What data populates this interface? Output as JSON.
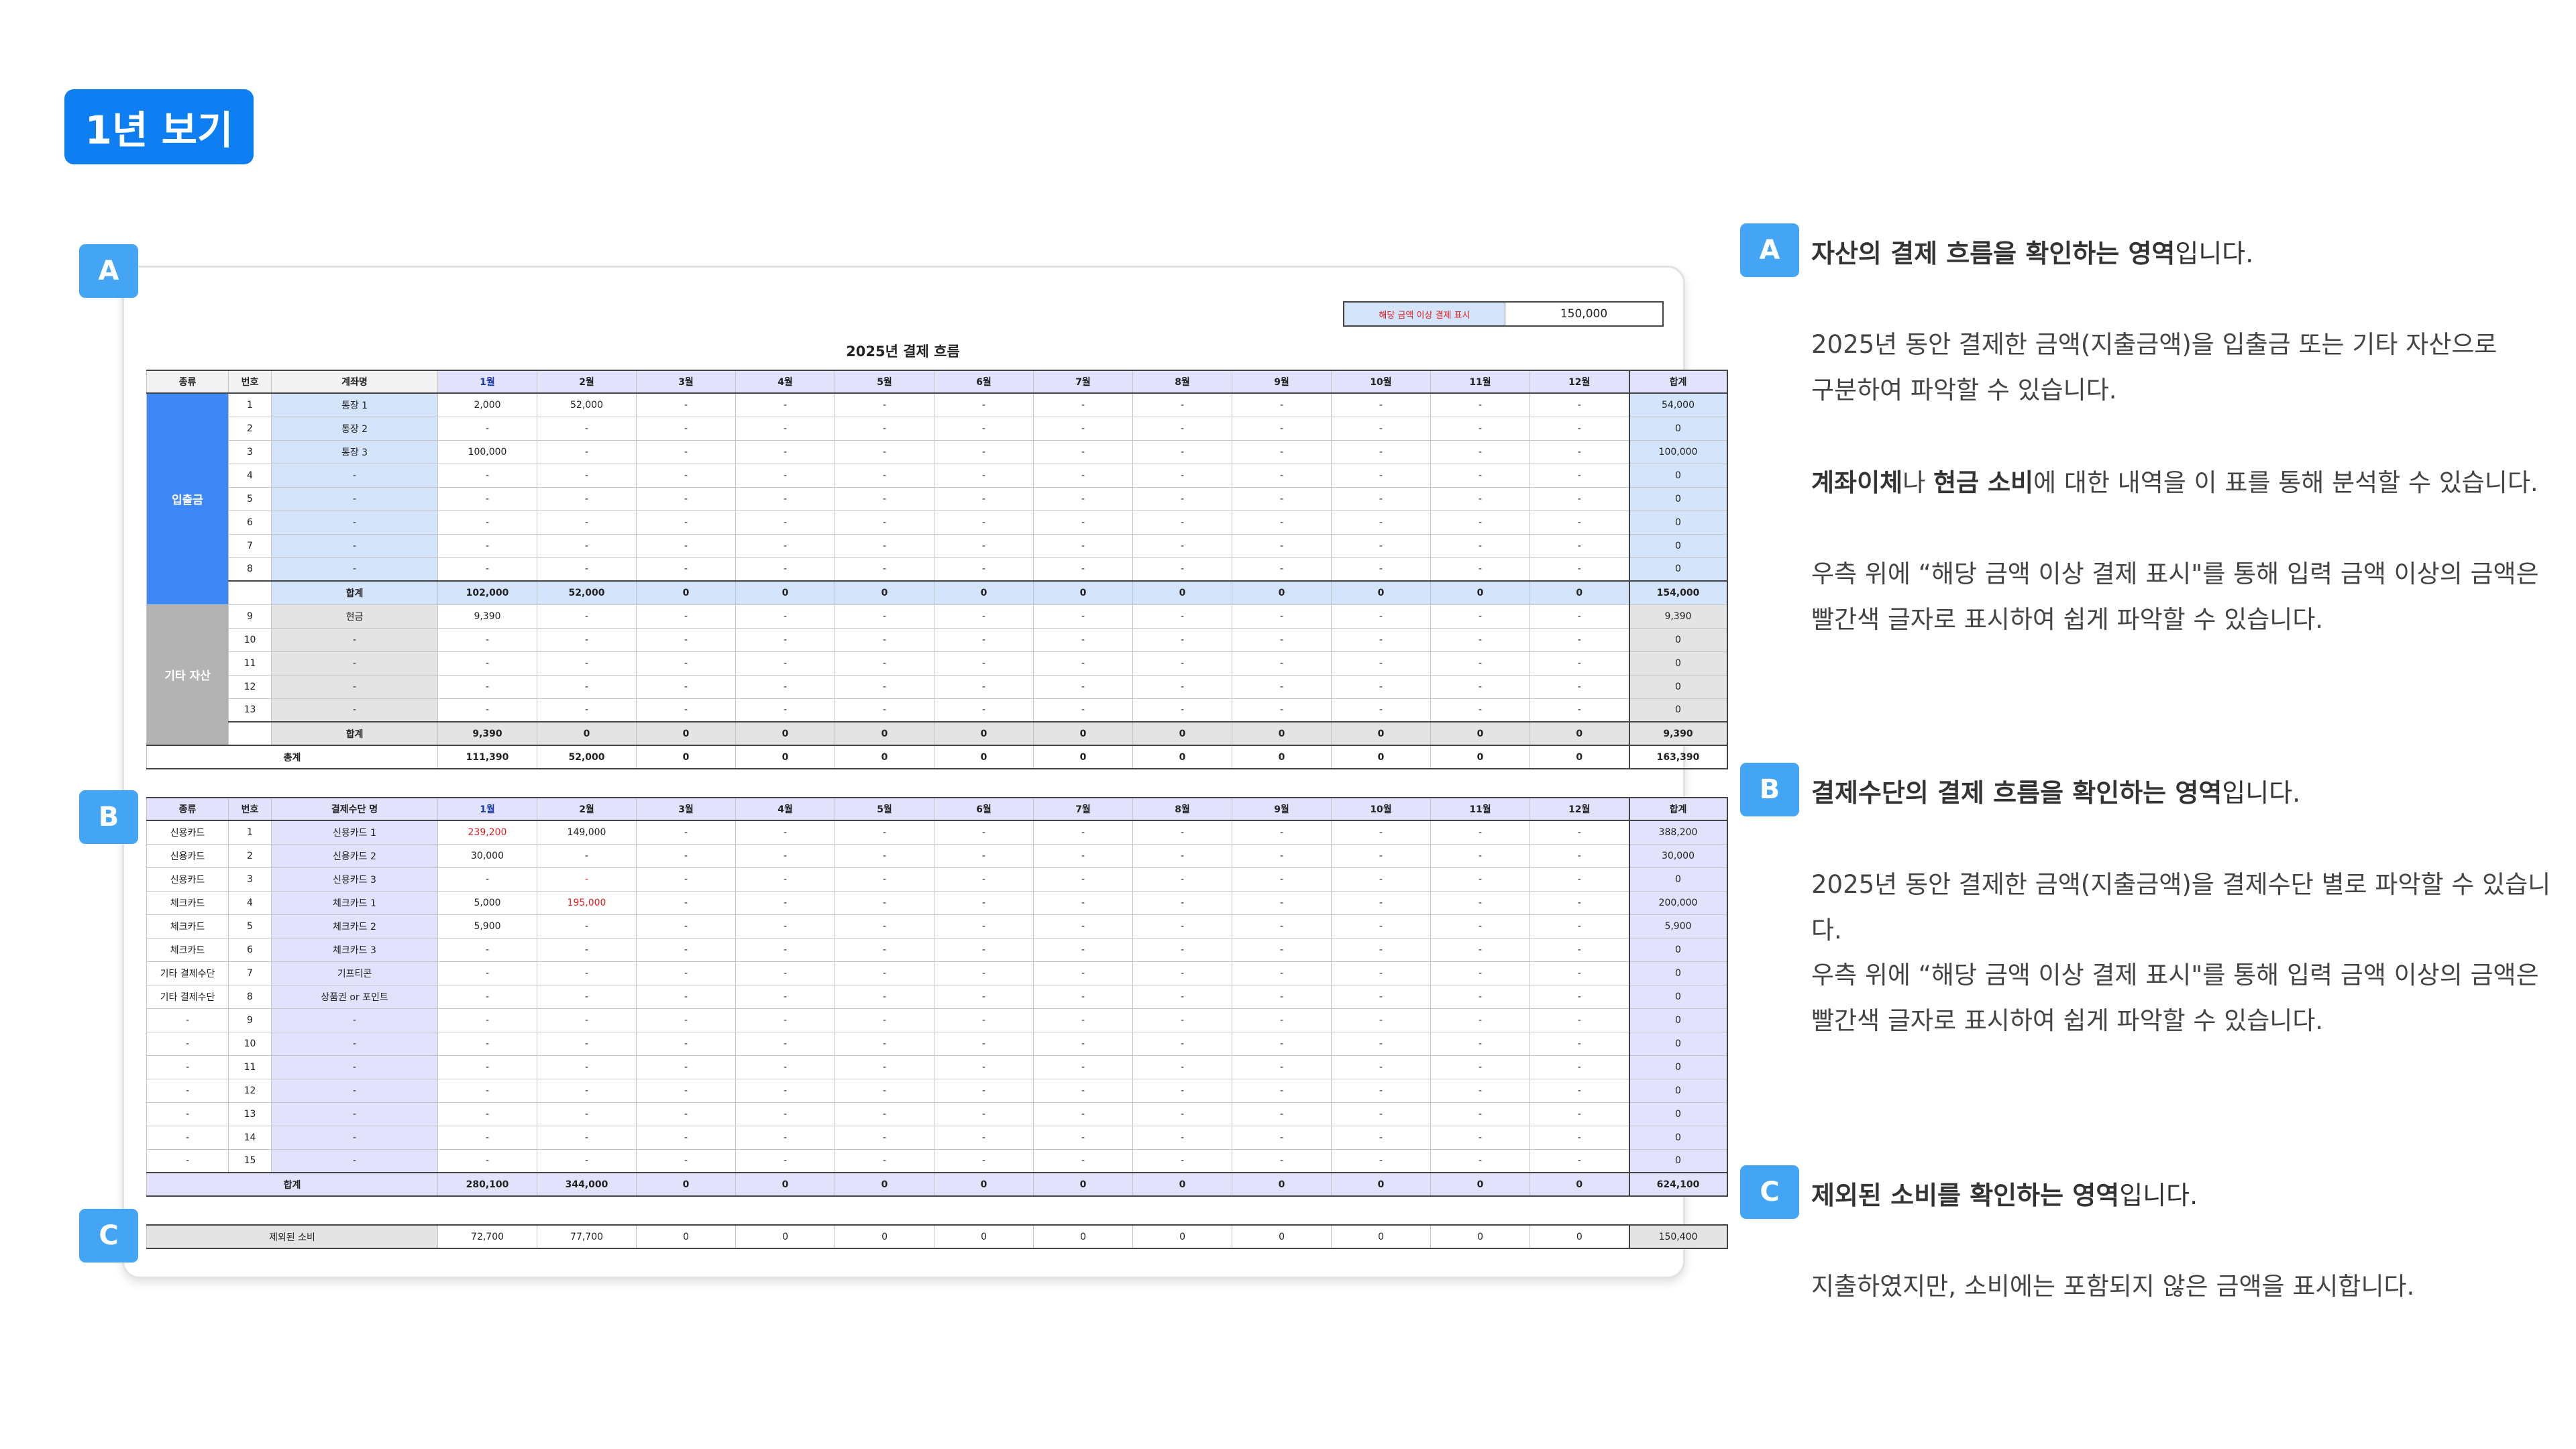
{
  "page": {
    "title": "1년 보기"
  },
  "markers": {
    "a": "A",
    "b": "B",
    "c": "C"
  },
  "colors": {
    "accent": "#0d7ff2",
    "marker": "#45a5f5",
    "asset_blue": "#3f87f5",
    "asset_gray": "#b3b3b3",
    "highlight_red": "#e02020"
  },
  "sheet": {
    "title": "2025년 결제 흐름",
    "threshold": {
      "label": "해당 금액 이상 결제 표시",
      "value": "150,000"
    },
    "months": [
      "1월",
      "2월",
      "3월",
      "4월",
      "5월",
      "6월",
      "7월",
      "8월",
      "9월",
      "10월",
      "11월",
      "12월"
    ],
    "total_header": "합계",
    "asset_table": {
      "headers": {
        "type": "종류",
        "num": "번호",
        "name": "계좌명"
      },
      "groups": [
        {
          "category": "입출금",
          "rows": [
            {
              "num": "1",
              "name": "통장 1",
              "months": [
                "2,000",
                "52,000",
                "-",
                "-",
                "-",
                "-",
                "-",
                "-",
                "-",
                "-",
                "-",
                "-"
              ],
              "total": "54,000"
            },
            {
              "num": "2",
              "name": "통장 2",
              "months": [
                "-",
                "-",
                "-",
                "-",
                "-",
                "-",
                "-",
                "-",
                "-",
                "-",
                "-",
                "-"
              ],
              "total": "0"
            },
            {
              "num": "3",
              "name": "통장 3",
              "months": [
                "100,000",
                "-",
                "-",
                "-",
                "-",
                "-",
                "-",
                "-",
                "-",
                "-",
                "-",
                "-"
              ],
              "total": "100,000"
            },
            {
              "num": "4",
              "name": "-",
              "months": [
                "-",
                "-",
                "-",
                "-",
                "-",
                "-",
                "-",
                "-",
                "-",
                "-",
                "-",
                "-"
              ],
              "total": "0"
            },
            {
              "num": "5",
              "name": "-",
              "months": [
                "-",
                "-",
                "-",
                "-",
                "-",
                "-",
                "-",
                "-",
                "-",
                "-",
                "-",
                "-"
              ],
              "total": "0"
            },
            {
              "num": "6",
              "name": "-",
              "months": [
                "-",
                "-",
                "-",
                "-",
                "-",
                "-",
                "-",
                "-",
                "-",
                "-",
                "-",
                "-"
              ],
              "total": "0"
            },
            {
              "num": "7",
              "name": "-",
              "months": [
                "-",
                "-",
                "-",
                "-",
                "-",
                "-",
                "-",
                "-",
                "-",
                "-",
                "-",
                "-"
              ],
              "total": "0"
            },
            {
              "num": "8",
              "name": "-",
              "months": [
                "-",
                "-",
                "-",
                "-",
                "-",
                "-",
                "-",
                "-",
                "-",
                "-",
                "-",
                "-"
              ],
              "total": "0"
            }
          ],
          "subtotal": {
            "label": "합계",
            "months": [
              "102,000",
              "52,000",
              "0",
              "0",
              "0",
              "0",
              "0",
              "0",
              "0",
              "0",
              "0",
              "0"
            ],
            "total": "154,000"
          }
        },
        {
          "category": "기타 자산",
          "rows": [
            {
              "num": "9",
              "name": "현금",
              "months": [
                "9,390",
                "-",
                "-",
                "-",
                "-",
                "-",
                "-",
                "-",
                "-",
                "-",
                "-",
                "-"
              ],
              "total": "9,390"
            },
            {
              "num": "10",
              "name": "-",
              "months": [
                "-",
                "-",
                "-",
                "-",
                "-",
                "-",
                "-",
                "-",
                "-",
                "-",
                "-",
                "-"
              ],
              "total": "0"
            },
            {
              "num": "11",
              "name": "-",
              "months": [
                "-",
                "-",
                "-",
                "-",
                "-",
                "-",
                "-",
                "-",
                "-",
                "-",
                "-",
                "-"
              ],
              "total": "0"
            },
            {
              "num": "12",
              "name": "-",
              "months": [
                "-",
                "-",
                "-",
                "-",
                "-",
                "-",
                "-",
                "-",
                "-",
                "-",
                "-",
                "-"
              ],
              "total": "0"
            },
            {
              "num": "13",
              "name": "-",
              "months": [
                "-",
                "-",
                "-",
                "-",
                "-",
                "-",
                "-",
                "-",
                "-",
                "-",
                "-",
                "-"
              ],
              "total": "0"
            }
          ],
          "subtotal": {
            "label": "합계",
            "months": [
              "9,390",
              "0",
              "0",
              "0",
              "0",
              "0",
              "0",
              "0",
              "0",
              "0",
              "0",
              "0"
            ],
            "total": "9,390"
          }
        }
      ],
      "grand_total": {
        "label": "총계",
        "months": [
          "111,390",
          "52,000",
          "0",
          "0",
          "0",
          "0",
          "0",
          "0",
          "0",
          "0",
          "0",
          "0"
        ],
        "total": "163,390"
      }
    },
    "payment_table": {
      "headers": {
        "type": "종류",
        "num": "번호",
        "name": "결제수단 명"
      },
      "rows": [
        {
          "type": "신용카드",
          "num": "1",
          "name": "신용카드 1",
          "months": [
            "239,200",
            "149,000",
            "-",
            "-",
            "-",
            "-",
            "-",
            "-",
            "-",
            "-",
            "-",
            "-"
          ],
          "total": "388,200",
          "red": [
            0
          ]
        },
        {
          "type": "신용카드",
          "num": "2",
          "name": "신용카드 2",
          "months": [
            "30,000",
            "-",
            "-",
            "-",
            "-",
            "-",
            "-",
            "-",
            "-",
            "-",
            "-",
            "-"
          ],
          "total": "30,000",
          "red": []
        },
        {
          "type": "신용카드",
          "num": "3",
          "name": "신용카드 3",
          "months": [
            "-",
            "-",
            "-",
            "-",
            "-",
            "-",
            "-",
            "-",
            "-",
            "-",
            "-",
            "-"
          ],
          "total": "0",
          "red": [
            1
          ]
        },
        {
          "type": "체크카드",
          "num": "4",
          "name": "체크카드 1",
          "months": [
            "5,000",
            "195,000",
            "-",
            "-",
            "-",
            "-",
            "-",
            "-",
            "-",
            "-",
            "-",
            "-"
          ],
          "total": "200,000",
          "red": [
            1
          ]
        },
        {
          "type": "체크카드",
          "num": "5",
          "name": "체크카드 2",
          "months": [
            "5,900",
            "-",
            "-",
            "-",
            "-",
            "-",
            "-",
            "-",
            "-",
            "-",
            "-",
            "-"
          ],
          "total": "5,900",
          "red": []
        },
        {
          "type": "체크카드",
          "num": "6",
          "name": "체크카드 3",
          "months": [
            "-",
            "-",
            "-",
            "-",
            "-",
            "-",
            "-",
            "-",
            "-",
            "-",
            "-",
            "-"
          ],
          "total": "0",
          "red": []
        },
        {
          "type": "기타 결제수단",
          "num": "7",
          "name": "기프티콘",
          "months": [
            "-",
            "-",
            "-",
            "-",
            "-",
            "-",
            "-",
            "-",
            "-",
            "-",
            "-",
            "-"
          ],
          "total": "0",
          "red": []
        },
        {
          "type": "기타 결제수단",
          "num": "8",
          "name": "상품권 or 포인트",
          "months": [
            "-",
            "-",
            "-",
            "-",
            "-",
            "-",
            "-",
            "-",
            "-",
            "-",
            "-",
            "-"
          ],
          "total": "0",
          "red": []
        },
        {
          "type": "-",
          "num": "9",
          "name": "-",
          "months": [
            "-",
            "-",
            "-",
            "-",
            "-",
            "-",
            "-",
            "-",
            "-",
            "-",
            "-",
            "-"
          ],
          "total": "0",
          "red": []
        },
        {
          "type": "-",
          "num": "10",
          "name": "-",
          "months": [
            "-",
            "-",
            "-",
            "-",
            "-",
            "-",
            "-",
            "-",
            "-",
            "-",
            "-",
            "-"
          ],
          "total": "0",
          "red": []
        },
        {
          "type": "-",
          "num": "11",
          "name": "-",
          "months": [
            "-",
            "-",
            "-",
            "-",
            "-",
            "-",
            "-",
            "-",
            "-",
            "-",
            "-",
            "-"
          ],
          "total": "0",
          "red": []
        },
        {
          "type": "-",
          "num": "12",
          "name": "-",
          "months": [
            "-",
            "-",
            "-",
            "-",
            "-",
            "-",
            "-",
            "-",
            "-",
            "-",
            "-",
            "-"
          ],
          "total": "0",
          "red": []
        },
        {
          "type": "-",
          "num": "13",
          "name": "-",
          "months": [
            "-",
            "-",
            "-",
            "-",
            "-",
            "-",
            "-",
            "-",
            "-",
            "-",
            "-",
            "-"
          ],
          "total": "0",
          "red": []
        },
        {
          "type": "-",
          "num": "14",
          "name": "-",
          "months": [
            "-",
            "-",
            "-",
            "-",
            "-",
            "-",
            "-",
            "-",
            "-",
            "-",
            "-",
            "-"
          ],
          "total": "0",
          "red": []
        },
        {
          "type": "-",
          "num": "15",
          "name": "-",
          "months": [
            "-",
            "-",
            "-",
            "-",
            "-",
            "-",
            "-",
            "-",
            "-",
            "-",
            "-",
            "-"
          ],
          "total": "0",
          "red": []
        }
      ],
      "total": {
        "label": "합계",
        "months": [
          "280,100",
          "344,000",
          "0",
          "0",
          "0",
          "0",
          "0",
          "0",
          "0",
          "0",
          "0",
          "0"
        ],
        "total": "624,100"
      }
    },
    "excluded": {
      "label": "제외된 소비",
      "months": [
        "72,700",
        "77,700",
        "0",
        "0",
        "0",
        "0",
        "0",
        "0",
        "0",
        "0",
        "0",
        "0"
      ],
      "total": "150,400"
    }
  },
  "notes": {
    "a": {
      "marker": "A",
      "heading_bold": "자산의 결제 흐름을 확인하는 영역",
      "heading_rest": "입니다.",
      "p1_line1": "2025년 동안 결제한 금액(지출금액)을 입출금 또는 기타 자산으로",
      "p1_line2": "구분하여 파악할 수 있습니다.",
      "p2_bold1": "계좌이체",
      "p2_mid": "나 ",
      "p2_bold2": "현금 소비",
      "p2_rest": "에 대한 내역을 이 표를 통해 분석할 수 있습니다.",
      "p3_line1": "우측 위에 “해당 금액 이상 결제 표시\"를 통해 입력 금액 이상의 금액은",
      "p3_line2": "빨간색 글자로 표시하여 쉽게 파악할 수 있습니다."
    },
    "b": {
      "marker": "B",
      "heading_bold": "결제수단의 결제 흐름을 확인하는 영역",
      "heading_rest": "입니다.",
      "p1": "2025년 동안 결제한 금액(지출금액)을 결제수단 별로 파악할 수 있습니다.",
      "p2_line1": "우측 위에 “해당 금액 이상 결제 표시\"를 통해 입력 금액 이상의 금액은",
      "p2_line2": "빨간색 글자로 표시하여 쉽게 파악할 수 있습니다."
    },
    "c": {
      "marker": "C",
      "heading_bold": "제외된 소비를 확인하는 영역",
      "heading_rest": "입니다.",
      "p1": "지출하였지만, 소비에는 포함되지 않은 금액을 표시합니다."
    }
  }
}
